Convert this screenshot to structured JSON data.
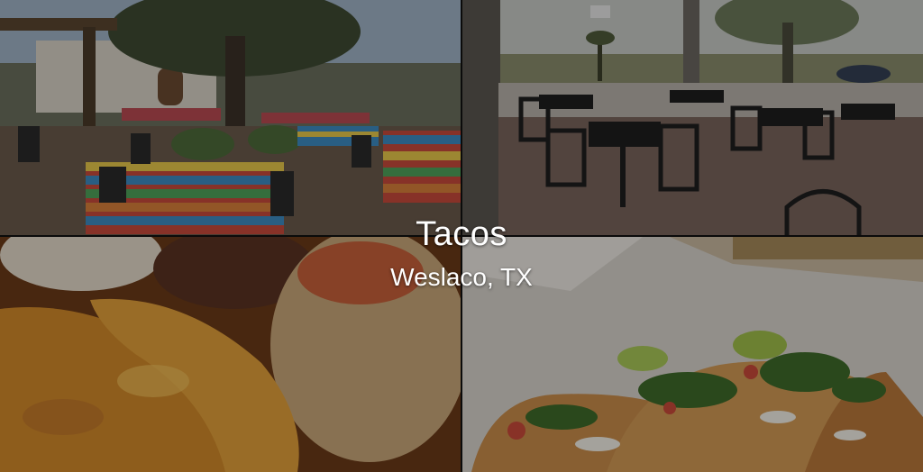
{
  "overlay": {
    "title": "Tacos",
    "location": "Weslaco, TX"
  },
  "tiles": [
    {
      "name": "patio-photo",
      "subject": "outdoor patio with striped tablecloths"
    },
    {
      "name": "covered-dining-photo",
      "subject": "covered dining area with iron tables"
    },
    {
      "name": "enchiladas-photo",
      "subject": "enchiladas with rice"
    },
    {
      "name": "tacos-photo",
      "subject": "tacos with cilantro and tomato"
    }
  ],
  "colors": {
    "overlay_text": "#ffffff",
    "dim": "rgba(0,0,0,0.32)"
  }
}
